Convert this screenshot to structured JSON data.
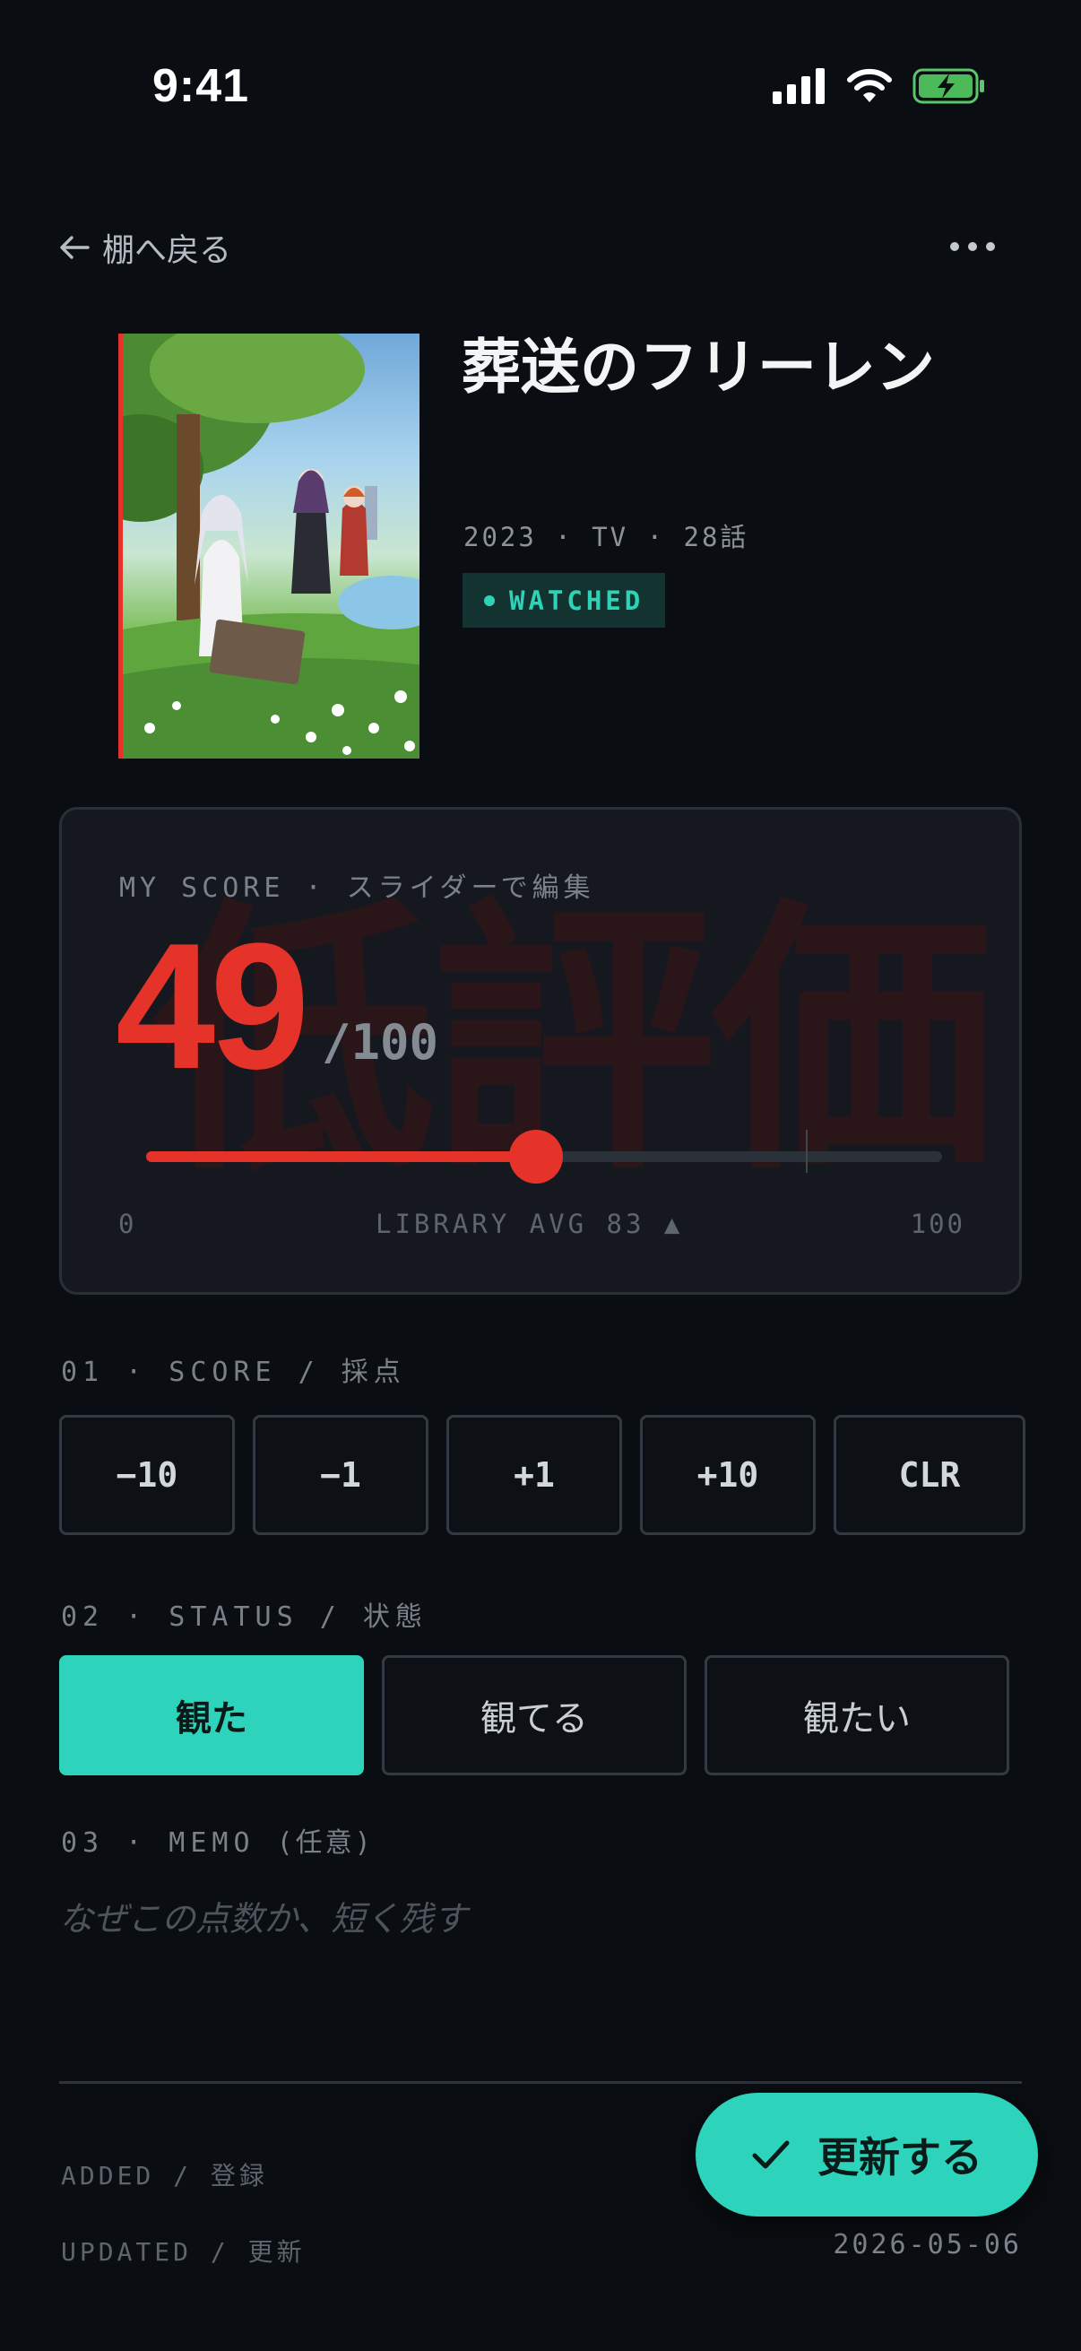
{
  "status_bar": {
    "time": "9:41"
  },
  "nav": {
    "back_label": "棚へ戻る"
  },
  "anime": {
    "title": "葬送のフリーレン",
    "meta": "2023 · TV · 28話",
    "status_badge": "WATCHED"
  },
  "score_card": {
    "label": "MY SCORE · スライダーで編集",
    "watermark": "低評価",
    "score": "49",
    "max_label": "/100",
    "slider": {
      "value": 49,
      "min": 0,
      "max": 100,
      "library_avg": 83
    },
    "min_label": "0",
    "avg_label": "LIBRARY AVG 83 ▲",
    "max_scale_label": "100"
  },
  "section_score": {
    "heading": "01 · SCORE / 採点",
    "buttons": [
      "−10",
      "−1",
      "+1",
      "+10",
      "CLR"
    ]
  },
  "section_status": {
    "heading": "02 · STATUS / 状態",
    "options": [
      "観た",
      "観てる",
      "観たい"
    ],
    "selected": "観た"
  },
  "section_memo": {
    "heading": "03 · MEMO",
    "heading_note": "(任意)",
    "placeholder": "なぜこの点数か、短く残す",
    "value": ""
  },
  "info": {
    "added_label": "ADDED / 登録",
    "added_value": "",
    "updated_label": "UPDATED / 更新",
    "updated_value": "2026-05-06"
  },
  "fab": {
    "label": "更新する"
  },
  "colors": {
    "background": "#0a0d11",
    "accent": "#2ed3bb",
    "danger": "#e53329",
    "card": "#15191f",
    "border": "#2a3038"
  }
}
